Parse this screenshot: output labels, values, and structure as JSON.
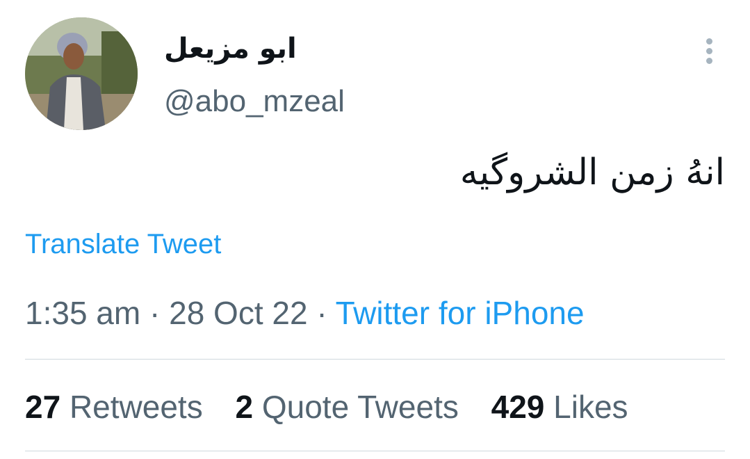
{
  "author": {
    "display_name": "ابو مزيعل",
    "handle": "@abo_mzeal",
    "avatar_icon": "profile-photo-man-headscarf"
  },
  "menu": {
    "icon": "more-vertical-icon"
  },
  "tweet": {
    "text": "انهُ زمن الشروگيه",
    "translate_label": "Translate Tweet",
    "time": "1:35 am",
    "separator": "·",
    "date": "28 Oct 22",
    "source": "Twitter for iPhone"
  },
  "stats": {
    "retweets": {
      "count": "27",
      "label": "Retweets"
    },
    "quotes": {
      "count": "2",
      "label": "Quote Tweets"
    },
    "likes": {
      "count": "429",
      "label": "Likes"
    }
  },
  "colors": {
    "link": "#1d9bf0",
    "secondary_text": "#536471",
    "primary_text": "#0f1419",
    "divider": "#cfd9de"
  }
}
